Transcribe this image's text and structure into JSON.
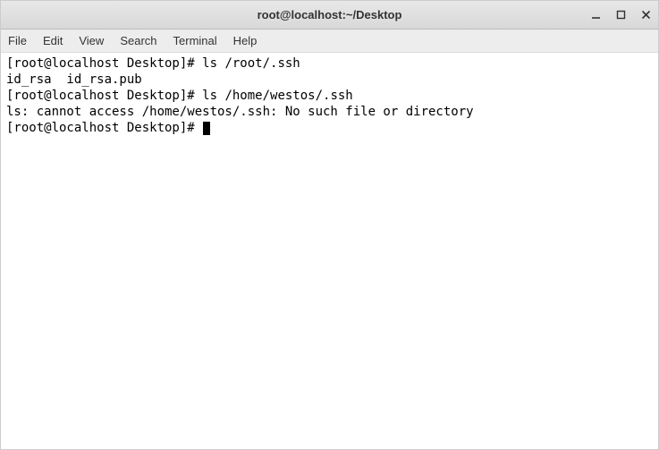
{
  "window": {
    "title": "root@localhost:~/Desktop"
  },
  "menubar": {
    "items": [
      "File",
      "Edit",
      "View",
      "Search",
      "Terminal",
      "Help"
    ]
  },
  "terminal": {
    "lines": [
      {
        "prompt": "[root@localhost Desktop]# ",
        "command": "ls /root/.ssh"
      },
      {
        "output": "id_rsa  id_rsa.pub"
      },
      {
        "prompt": "[root@localhost Desktop]# ",
        "command": "ls /home/westos/.ssh"
      },
      {
        "output": "ls: cannot access /home/westos/.ssh: No such file or directory"
      },
      {
        "prompt": "[root@localhost Desktop]# ",
        "cursor": true
      }
    ]
  }
}
